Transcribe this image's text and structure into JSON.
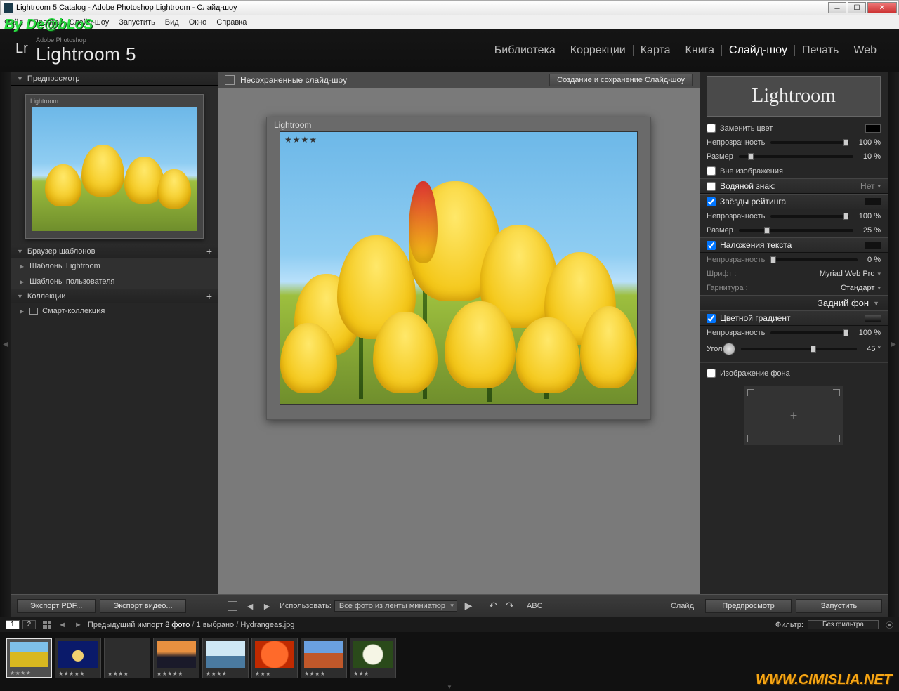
{
  "window": {
    "title": "Lightroom 5 Catalog - Adobe Photoshop Lightroom - Слайд-шоу"
  },
  "watermarks": {
    "top": "By De@bLoS",
    "bottom": "WWW.CIMISLIA.NET"
  },
  "menu": [
    "Файл",
    "Правка",
    "Слайд-шоу",
    "Запустить",
    "Вид",
    "Окно",
    "Справка"
  ],
  "brand": {
    "vendor": "Adobe Photoshop",
    "product": "Lightroom 5",
    "modules": [
      "Библиотека",
      "Коррекции",
      "Карта",
      "Книга",
      "Слайд-шоу",
      "Печать",
      "Web"
    ],
    "active_module": "Слайд-шоу"
  },
  "left": {
    "preview_title": "Предпросмотр",
    "identity_text": "Lightroom",
    "templates_title": "Браузер шаблонов",
    "templates": [
      "Шаблоны Lightroom",
      "Шаблоны пользователя"
    ],
    "collections_title": "Коллекции",
    "smart_collection": "Смарт-коллекция"
  },
  "center": {
    "title": "Несохраненные слайд-шоу",
    "save_btn": "Создание и сохранение Слайд-шоу",
    "identity": "Lightroom",
    "stars": "★★★★"
  },
  "right": {
    "identity_plate": "Lightroom",
    "replace_color": "Заменить цвет",
    "opacity": "Непрозрачность",
    "size": "Размер",
    "outside_image": "Вне изображения",
    "watermark_head": "Водяной знак:",
    "watermark_val": "Нет",
    "stars_head": "Звёзды рейтинга",
    "text_overlay_head": "Наложения текста",
    "font_lbl": "Шрифт :",
    "font_val": "Myriad Web Pro",
    "face_lbl": "Гарнитура :",
    "face_val": "Стандарт",
    "backdrop_title": "Задний фон",
    "gradient_head": "Цветной градиент",
    "angle": "Угол",
    "bg_image": "Изображение фона",
    "vals": {
      "id_opacity": "100 %",
      "id_size": "10 %",
      "stars_opacity": "100 %",
      "stars_size": "25 %",
      "text_opacity": "0 %",
      "grad_opacity": "100 %",
      "grad_angle": "45 °"
    }
  },
  "toolbar": {
    "export_pdf": "Экспорт PDF...",
    "export_video": "Экспорт видео...",
    "use_label": "Использовать:",
    "use_value": "Все фото из ленты миниатюр",
    "abc": "ABC",
    "slide": "Слайд",
    "preview_btn": "Предпросмотр",
    "play_btn": "Запустить"
  },
  "filmstrip": {
    "page1": "1",
    "page2": "2",
    "crumb_prefix": "Предыдущий импорт",
    "count": "8 фото",
    "selected": "1 выбрано",
    "filename": "Hydrangeas.jpg",
    "filter_lbl": "Фильтр:",
    "filter_val": "Без фильтра",
    "thumbs": [
      {
        "cls": "t-tulip",
        "stars": "★★★★",
        "sel": true
      },
      {
        "cls": "t-jelly",
        "stars": "★★★★★"
      },
      {
        "cls": "t-koala",
        "stars": "★★★★"
      },
      {
        "cls": "t-light",
        "stars": "★★★★★"
      },
      {
        "cls": "t-peng",
        "stars": "★★★★"
      },
      {
        "cls": "t-flower",
        "stars": "★★★"
      },
      {
        "cls": "t-desert",
        "stars": "★★★★"
      },
      {
        "cls": "t-hydr",
        "stars": "★★★"
      }
    ]
  }
}
